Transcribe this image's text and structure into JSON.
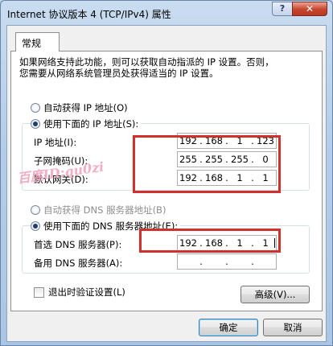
{
  "window": {
    "title": "Internet 协议版本 4 (TCP/IPv4) 属性",
    "help_label": "?",
    "close_label": "✕"
  },
  "tab": {
    "label": "常规"
  },
  "description": {
    "line1": "如果网络支持此功能，则可以获取自动指派的 IP 设置。否则，",
    "line2": "您需要从网络系统管理员处获得适当的 IP 设置。"
  },
  "ip_section": {
    "auto_label": "自动获得 IP 地址(O)",
    "manual_label": "使用下面的 IP 地址(S):",
    "selected": "manual",
    "ip_label": "IP 地址(I):",
    "ip_value": [
      "192",
      "168",
      "1",
      "123"
    ],
    "mask_label": "子网掩码(U):",
    "mask_value": [
      "255",
      "255",
      "255",
      "0"
    ],
    "gateway_label": "默认网关(D):",
    "gateway_value": [
      "192",
      "168",
      "1",
      "1"
    ]
  },
  "dns_section": {
    "auto_label": "自动获得 DNS 服务器地址(B)",
    "manual_label": "使用下面的 DNS 服务器地址(E):",
    "selected": "manual",
    "preferred_label": "首选 DNS 服务器(P):",
    "preferred_value": [
      "192",
      "168",
      "1",
      "1"
    ],
    "alternate_label": "备用 DNS 服务器(A):",
    "alternate_value": [
      "",
      "",
      "",
      ""
    ]
  },
  "validate_checkbox": {
    "label": "退出时验证设置(L)",
    "checked": false
  },
  "buttons": {
    "advanced": "高级(V)...",
    "ok": "确定",
    "cancel": "取消"
  },
  "watermark": "百度ID:qu0zi",
  "colors": {
    "highlight_box": "#d0312d",
    "title_bar": "#b5cde8"
  }
}
